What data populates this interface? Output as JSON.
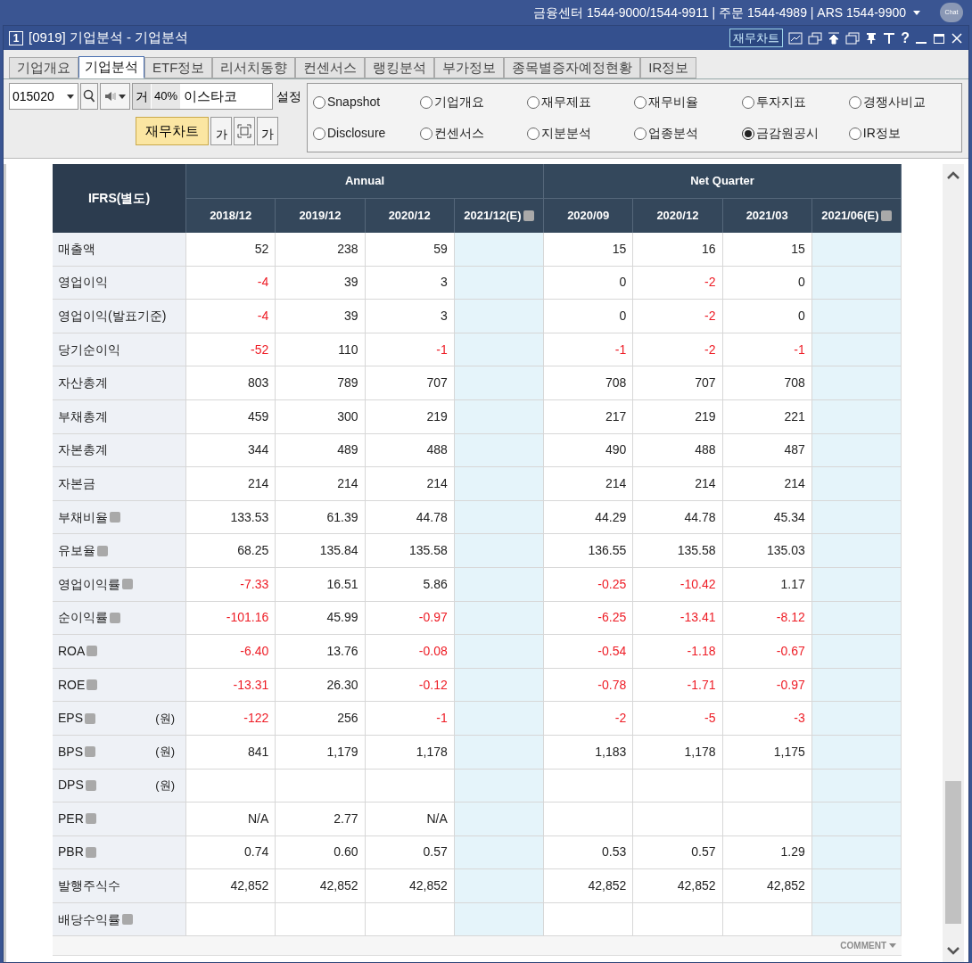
{
  "top_bar": {
    "info": "금융센터 1544-9000/1544-9911 | 주문 1544-4989 | ARS 1544-9900",
    "chat": "Chat"
  },
  "window": {
    "number": "1",
    "title": "[0919] 기업분석 - 기업분석",
    "chart_button": "재무차트",
    "help": "?"
  },
  "tabs": [
    {
      "label": "기업개요",
      "selected": false
    },
    {
      "label": "기업분석",
      "selected": true
    },
    {
      "label": "ETF정보",
      "selected": false
    },
    {
      "label": "리서치동향",
      "selected": false
    },
    {
      "label": "컨센서스",
      "selected": false
    },
    {
      "label": "랭킹분석",
      "selected": false
    },
    {
      "label": "부가정보",
      "selected": false
    },
    {
      "label": "종목별증자예정현황",
      "selected": false
    },
    {
      "label": "IR정보",
      "selected": false
    }
  ],
  "toolbar": {
    "code": "015020",
    "market": "거",
    "ratio": "40%",
    "name": "이스타코",
    "settings": "설정",
    "chart_button": "재무차트",
    "font_small": "가",
    "font_large": "가"
  },
  "options": [
    {
      "label": "Snapshot",
      "selected": false
    },
    {
      "label": "기업개요",
      "selected": false
    },
    {
      "label": "재무제표",
      "selected": false
    },
    {
      "label": "재무비율",
      "selected": false
    },
    {
      "label": "투자지표",
      "selected": false
    },
    {
      "label": "경쟁사비교",
      "selected": false
    },
    {
      "label": "Disclosure",
      "selected": false
    },
    {
      "label": "컨센서스",
      "selected": false
    },
    {
      "label": "지분분석",
      "selected": false
    },
    {
      "label": "업종분석",
      "selected": false
    },
    {
      "label": "금감원공시",
      "selected": true
    },
    {
      "label": "IR정보",
      "selected": false
    }
  ],
  "table": {
    "corner": "IFRS(별도)",
    "groups": [
      "Annual",
      "Net Quarter"
    ],
    "columns": [
      {
        "label": "2018/12",
        "estimate": false
      },
      {
        "label": "2019/12",
        "estimate": false
      },
      {
        "label": "2020/12",
        "estimate": false
      },
      {
        "label": "2021/12(E)",
        "estimate": true
      },
      {
        "label": "2020/09",
        "estimate": false
      },
      {
        "label": "2020/12",
        "estimate": false
      },
      {
        "label": "2021/03",
        "estimate": false
      },
      {
        "label": "2021/06(E)",
        "estimate": true
      }
    ],
    "rows": [
      {
        "label": "매출액",
        "help": false,
        "cells": [
          {
            "text": "52",
            "negative": false
          },
          {
            "text": "238",
            "negative": false
          },
          {
            "text": "59",
            "negative": false
          },
          {},
          {
            "text": "15",
            "negative": false
          },
          {
            "text": "16",
            "negative": false
          },
          {
            "text": "15",
            "negative": false
          },
          {}
        ]
      },
      {
        "label": "영업이익",
        "help": false,
        "cells": [
          {
            "text": "-4",
            "negative": true
          },
          {
            "text": "39",
            "negative": false
          },
          {
            "text": "3",
            "negative": false
          },
          {},
          {
            "text": "0",
            "negative": false
          },
          {
            "text": "-2",
            "negative": true
          },
          {
            "text": "0",
            "negative": false
          },
          {}
        ]
      },
      {
        "label": "영업이익(발표기준)",
        "help": false,
        "cells": [
          {
            "text": "-4",
            "negative": true
          },
          {
            "text": "39",
            "negative": false
          },
          {
            "text": "3",
            "negative": false
          },
          {},
          {
            "text": "0",
            "negative": false
          },
          {
            "text": "-2",
            "negative": true
          },
          {
            "text": "0",
            "negative": false
          },
          {}
        ]
      },
      {
        "label": "당기순이익",
        "help": false,
        "cells": [
          {
            "text": "-52",
            "negative": true
          },
          {
            "text": "110",
            "negative": false
          },
          {
            "text": "-1",
            "negative": true
          },
          {},
          {
            "text": "-1",
            "negative": true
          },
          {
            "text": "-2",
            "negative": true
          },
          {
            "text": "-1",
            "negative": true
          },
          {}
        ]
      },
      {
        "label": "자산총계",
        "help": false,
        "cells": [
          {
            "text": "803",
            "negative": false
          },
          {
            "text": "789",
            "negative": false
          },
          {
            "text": "707",
            "negative": false
          },
          {},
          {
            "text": "708",
            "negative": false
          },
          {
            "text": "707",
            "negative": false
          },
          {
            "text": "708",
            "negative": false
          },
          {}
        ]
      },
      {
        "label": "부채총계",
        "help": false,
        "cells": [
          {
            "text": "459",
            "negative": false
          },
          {
            "text": "300",
            "negative": false
          },
          {
            "text": "219",
            "negative": false
          },
          {},
          {
            "text": "217",
            "negative": false
          },
          {
            "text": "219",
            "negative": false
          },
          {
            "text": "221",
            "negative": false
          },
          {}
        ]
      },
      {
        "label": "자본총계",
        "help": false,
        "cells": [
          {
            "text": "344",
            "negative": false
          },
          {
            "text": "489",
            "negative": false
          },
          {
            "text": "488",
            "negative": false
          },
          {},
          {
            "text": "490",
            "negative": false
          },
          {
            "text": "488",
            "negative": false
          },
          {
            "text": "487",
            "negative": false
          },
          {}
        ]
      },
      {
        "label": "자본금",
        "help": false,
        "cells": [
          {
            "text": "214",
            "negative": false
          },
          {
            "text": "214",
            "negative": false
          },
          {
            "text": "214",
            "negative": false
          },
          {},
          {
            "text": "214",
            "negative": false
          },
          {
            "text": "214",
            "negative": false
          },
          {
            "text": "214",
            "negative": false
          },
          {}
        ]
      },
      {
        "label": "부채비율",
        "help": true,
        "cells": [
          {
            "text": "133.53",
            "negative": false
          },
          {
            "text": "61.39",
            "negative": false
          },
          {
            "text": "44.78",
            "negative": false
          },
          {},
          {
            "text": "44.29",
            "negative": false
          },
          {
            "text": "44.78",
            "negative": false
          },
          {
            "text": "45.34",
            "negative": false
          },
          {}
        ]
      },
      {
        "label": "유보율",
        "help": true,
        "cells": [
          {
            "text": "68.25",
            "negative": false
          },
          {
            "text": "135.84",
            "negative": false
          },
          {
            "text": "135.58",
            "negative": false
          },
          {},
          {
            "text": "136.55",
            "negative": false
          },
          {
            "text": "135.58",
            "negative": false
          },
          {
            "text": "135.03",
            "negative": false
          },
          {}
        ]
      },
      {
        "label": "영업이익률",
        "help": true,
        "cells": [
          {
            "text": "-7.33",
            "negative": true
          },
          {
            "text": "16.51",
            "negative": false
          },
          {
            "text": "5.86",
            "negative": false
          },
          {},
          {
            "text": "-0.25",
            "negative": true
          },
          {
            "text": "-10.42",
            "negative": true
          },
          {
            "text": "1.17",
            "negative": false
          },
          {}
        ]
      },
      {
        "label": "순이익률",
        "help": true,
        "cells": [
          {
            "text": "-101.16",
            "negative": true
          },
          {
            "text": "45.99",
            "negative": false
          },
          {
            "text": "-0.97",
            "negative": true
          },
          {},
          {
            "text": "-6.25",
            "negative": true
          },
          {
            "text": "-13.41",
            "negative": true
          },
          {
            "text": "-8.12",
            "negative": true
          },
          {}
        ]
      },
      {
        "label": "ROA",
        "help": true,
        "cells": [
          {
            "text": "-6.40",
            "negative": true
          },
          {
            "text": "13.76",
            "negative": false
          },
          {
            "text": "-0.08",
            "negative": true
          },
          {},
          {
            "text": "-0.54",
            "negative": true
          },
          {
            "text": "-1.18",
            "negative": true
          },
          {
            "text": "-0.67",
            "negative": true
          },
          {}
        ]
      },
      {
        "label": "ROE",
        "help": true,
        "cells": [
          {
            "text": "-13.31",
            "negative": true
          },
          {
            "text": "26.30",
            "negative": false
          },
          {
            "text": "-0.12",
            "negative": true
          },
          {},
          {
            "text": "-0.78",
            "negative": true
          },
          {
            "text": "-1.71",
            "negative": true
          },
          {
            "text": "-0.97",
            "negative": true
          },
          {}
        ]
      },
      {
        "label": "EPS",
        "help": true,
        "unit": "(원)",
        "cells": [
          {
            "text": "-122",
            "negative": true
          },
          {
            "text": "256",
            "negative": false
          },
          {
            "text": "-1",
            "negative": true
          },
          {},
          {
            "text": "-2",
            "negative": true
          },
          {
            "text": "-5",
            "negative": true
          },
          {
            "text": "-3",
            "negative": true
          },
          {}
        ]
      },
      {
        "label": "BPS",
        "help": true,
        "unit": "(원)",
        "cells": [
          {
            "text": "841",
            "negative": false
          },
          {
            "text": "1,179",
            "negative": false
          },
          {
            "text": "1,178",
            "negative": false
          },
          {},
          {
            "text": "1,183",
            "negative": false
          },
          {
            "text": "1,178",
            "negative": false
          },
          {
            "text": "1,175",
            "negative": false
          },
          {}
        ]
      },
      {
        "label": "DPS",
        "help": true,
        "unit": "(원)",
        "cells": [
          {},
          {},
          {},
          {},
          {},
          {},
          {},
          {}
        ]
      },
      {
        "label": "PER",
        "help": true,
        "cells": [
          {
            "text": "N/A",
            "negative": false
          },
          {
            "text": "2.77",
            "negative": false
          },
          {
            "text": "N/A",
            "negative": false
          },
          {},
          {},
          {},
          {},
          {}
        ]
      },
      {
        "label": "PBR",
        "help": true,
        "cells": [
          {
            "text": "0.74",
            "negative": false
          },
          {
            "text": "0.60",
            "negative": false
          },
          {
            "text": "0.57",
            "negative": false
          },
          {},
          {
            "text": "0.53",
            "negative": false
          },
          {
            "text": "0.57",
            "negative": false
          },
          {
            "text": "1.29",
            "negative": false
          },
          {}
        ]
      },
      {
        "label": "발행주식수",
        "help": false,
        "cells": [
          {
            "text": "42,852",
            "negative": false
          },
          {
            "text": "42,852",
            "negative": false
          },
          {
            "text": "42,852",
            "negative": false
          },
          {},
          {
            "text": "42,852",
            "negative": false
          },
          {
            "text": "42,852",
            "negative": false
          },
          {
            "text": "42,852",
            "negative": false
          },
          {}
        ]
      },
      {
        "label": "배당수익률",
        "help": true,
        "cells": [
          {},
          {},
          {},
          {},
          {},
          {},
          {},
          {}
        ]
      }
    ],
    "footer": "COMMENT"
  }
}
